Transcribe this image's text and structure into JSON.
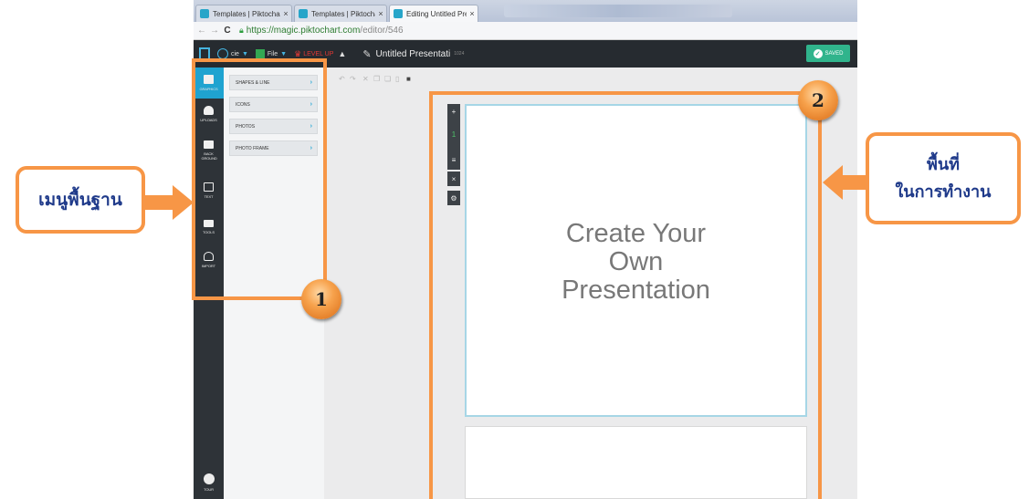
{
  "browser": {
    "tabs": [
      {
        "title": "Templates | Piktochart",
        "active": false
      },
      {
        "title": "Templates | Piktochart",
        "active": false
      },
      {
        "title": "Editing Untitled Presentat",
        "active": true
      }
    ],
    "close_glyph": "×",
    "back_glyph": "←",
    "forward_glyph": "→",
    "reload_glyph": "C",
    "url_host": "https://magic.piktochart.com",
    "url_path": "/editor/546"
  },
  "app_toolbar": {
    "user_label": "cie",
    "file_label": "File",
    "level_up_label": "LEVEL UP",
    "document_title": "Untitled Presentati",
    "document_size": "1024",
    "saved_label": "SAVED",
    "icons": {
      "logo": "logo-icon",
      "user": "user-icon",
      "bell": "bell-icon",
      "pen": "pen-icon",
      "check": "check-icon"
    }
  },
  "sidebar": {
    "items": [
      {
        "label": "GRAPHICS",
        "icon": "image-icon",
        "active": true
      },
      {
        "label": "UPLOADS",
        "icon": "cloud-upload-icon",
        "active": false
      },
      {
        "label": "BACK GROUND",
        "icon": "monitor-icon",
        "active": false
      },
      {
        "label": "TEXT",
        "icon": "text-icon",
        "active": false
      },
      {
        "label": "TOOLS",
        "icon": "toolbox-icon",
        "active": false
      },
      {
        "label": "IMPORT",
        "icon": "import-icon",
        "active": false
      }
    ],
    "tour_label": "TOUR"
  },
  "graphics_panel": {
    "items": [
      {
        "label": "SHAPES & LINE"
      },
      {
        "label": "ICONS"
      },
      {
        "label": "PHOTOS"
      },
      {
        "label": "PHOTO FRAME"
      }
    ],
    "chevron_glyph": "›"
  },
  "canvas": {
    "slide_text": "Create Your\nOwn\nPresentation",
    "slide_tools": [
      "+",
      "1",
      "•",
      "≡",
      "×",
      "⚙"
    ]
  },
  "annotations": {
    "left_callout": "เมนูพื้นฐาน",
    "right_callout": "พื้นที่\nในการทำงาน",
    "badge_1": "1",
    "badge_2": "2",
    "accent_color": "#f79646",
    "text_color": "#1f3a8a"
  },
  "colors": {
    "toolbar_dark": "#262b30",
    "sidebar_dark": "#2e3338",
    "active_blue": "#1fa3d0",
    "saved_green": "#30b48c"
  }
}
